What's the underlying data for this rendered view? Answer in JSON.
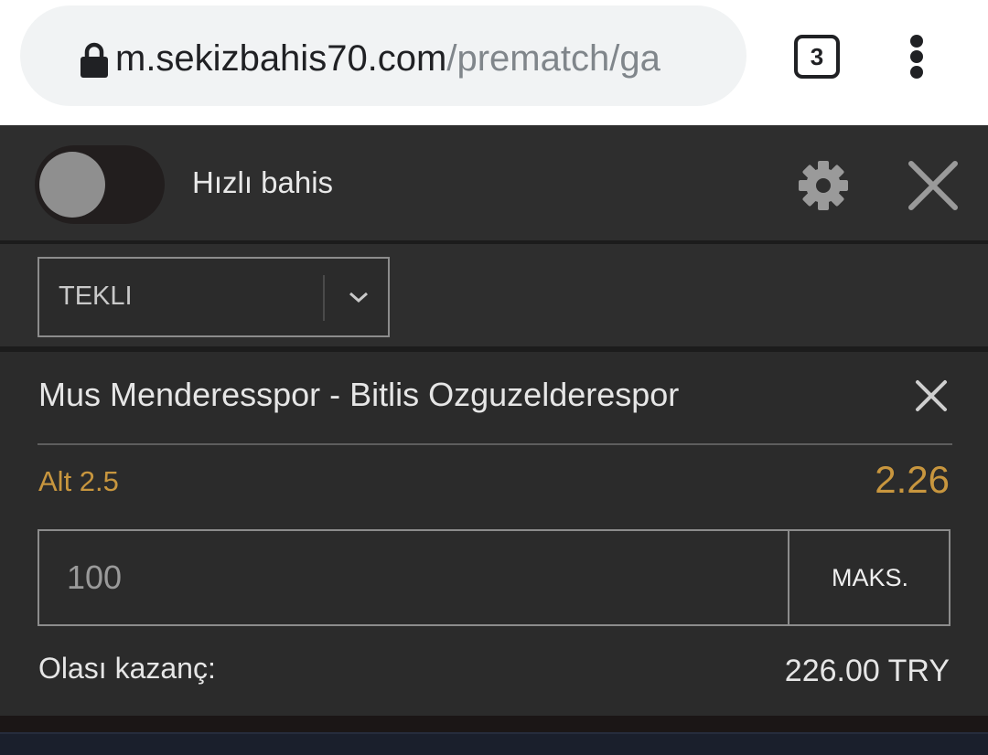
{
  "browser": {
    "url_host": "m.sekizbahis70.com",
    "url_path": "/prematch/ga",
    "tab_count": "3"
  },
  "betslip": {
    "quick_bet_label": "Hızlı bahis",
    "quick_bet_enabled": false,
    "bet_type": "TEKLI",
    "match": "Mus Menderesspor - Bitlis Ozguzelderespor",
    "selection": "Alt 2.5",
    "odds": "2.26",
    "stake_placeholder": "100",
    "max_label": "MAKS.",
    "potential_win_label": "Olası kazanç:",
    "potential_win_value": "226.00 TRY"
  },
  "colors": {
    "accent": "#c8963e",
    "panel_bg": "#2b2b2b",
    "header_bg": "#2e2e2e"
  },
  "icons": [
    "lock-icon",
    "tabs-icon",
    "more-vert-icon",
    "gear-icon",
    "close-icon",
    "chevron-down-icon"
  ]
}
